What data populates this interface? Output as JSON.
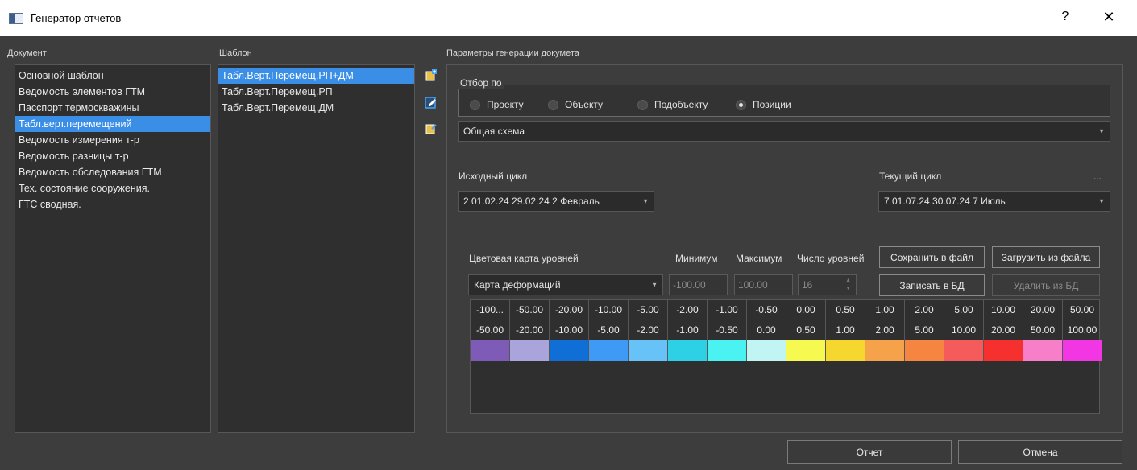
{
  "window": {
    "title": "Генератор отчетов",
    "help": "?",
    "close": "✕"
  },
  "document": {
    "label": "Документ",
    "items": [
      "Основной шаблон",
      "Ведомость элементов ГТМ",
      "Пасспорт термоскважины",
      "Табл.верт.перемещений",
      "Ведомость измерения т-р",
      "Ведомость разницы т-р",
      "Ведомость обследования ГТМ",
      "Тех. состояние сооружения.",
      "ГТС сводная."
    ],
    "selected_index": 3
  },
  "template": {
    "label": "Шаблон",
    "items": [
      "Табл.Верт.Перемещ.РП+ДМ",
      "Табл.Верт.Перемещ.РП",
      "Табл.Верт.Перемещ.ДМ"
    ],
    "selected_index": 0
  },
  "params": {
    "label": "Параметры генерации докумета",
    "filter": {
      "title": "Отбор по",
      "options": [
        "Проекту",
        "Объекту",
        "Подобъекту",
        "Позиции"
      ],
      "selected": "Позиции"
    },
    "scheme": "Общая схема",
    "source_cycle": {
      "label": "Исходный цикл",
      "value": "2 01.02.24 29.02.24 2 Февраль"
    },
    "current_cycle": {
      "label": "Текущий цикл",
      "value": "7 01.07.24 30.07.24 7 Июль",
      "more": "..."
    },
    "colormap": {
      "label": "Цветовая карта уровней",
      "value": "Карта деформаций",
      "min_label": "Минимум",
      "max_label": "Максимум",
      "levels_label": "Число уровней",
      "min": "-100.00",
      "max": "100.00",
      "levels": "16",
      "save_file": "Сохранить в файл",
      "load_file": "Загрузить из файла",
      "write_db": "Записать в БД",
      "delete_db": "Удалить из БД"
    },
    "levels": {
      "from": [
        "-100...",
        "-50.00",
        "-20.00",
        "-10.00",
        "-5.00",
        "-2.00",
        "-1.00",
        "-0.50",
        "0.00",
        "0.50",
        "1.00",
        "2.00",
        "5.00",
        "10.00",
        "20.00",
        "50.00"
      ],
      "to": [
        "-50.00",
        "-20.00",
        "-10.00",
        "-5.00",
        "-2.00",
        "-1.00",
        "-0.50",
        "0.00",
        "0.50",
        "1.00",
        "2.00",
        "5.00",
        "10.00",
        "20.00",
        "50.00",
        "100.00"
      ],
      "colors": [
        "#7e5bb7",
        "#a9a4dc",
        "#0f6fd6",
        "#3f9af5",
        "#66c2f7",
        "#2ed0e6",
        "#4af3f2",
        "#c0f5f3",
        "#f6f94f",
        "#f5d72f",
        "#f6a24a",
        "#f58541",
        "#f55b5b",
        "#f5302f",
        "#f77fca",
        "#f236e4"
      ]
    }
  },
  "footer": {
    "report": "Отчет",
    "cancel": "Отмена"
  }
}
